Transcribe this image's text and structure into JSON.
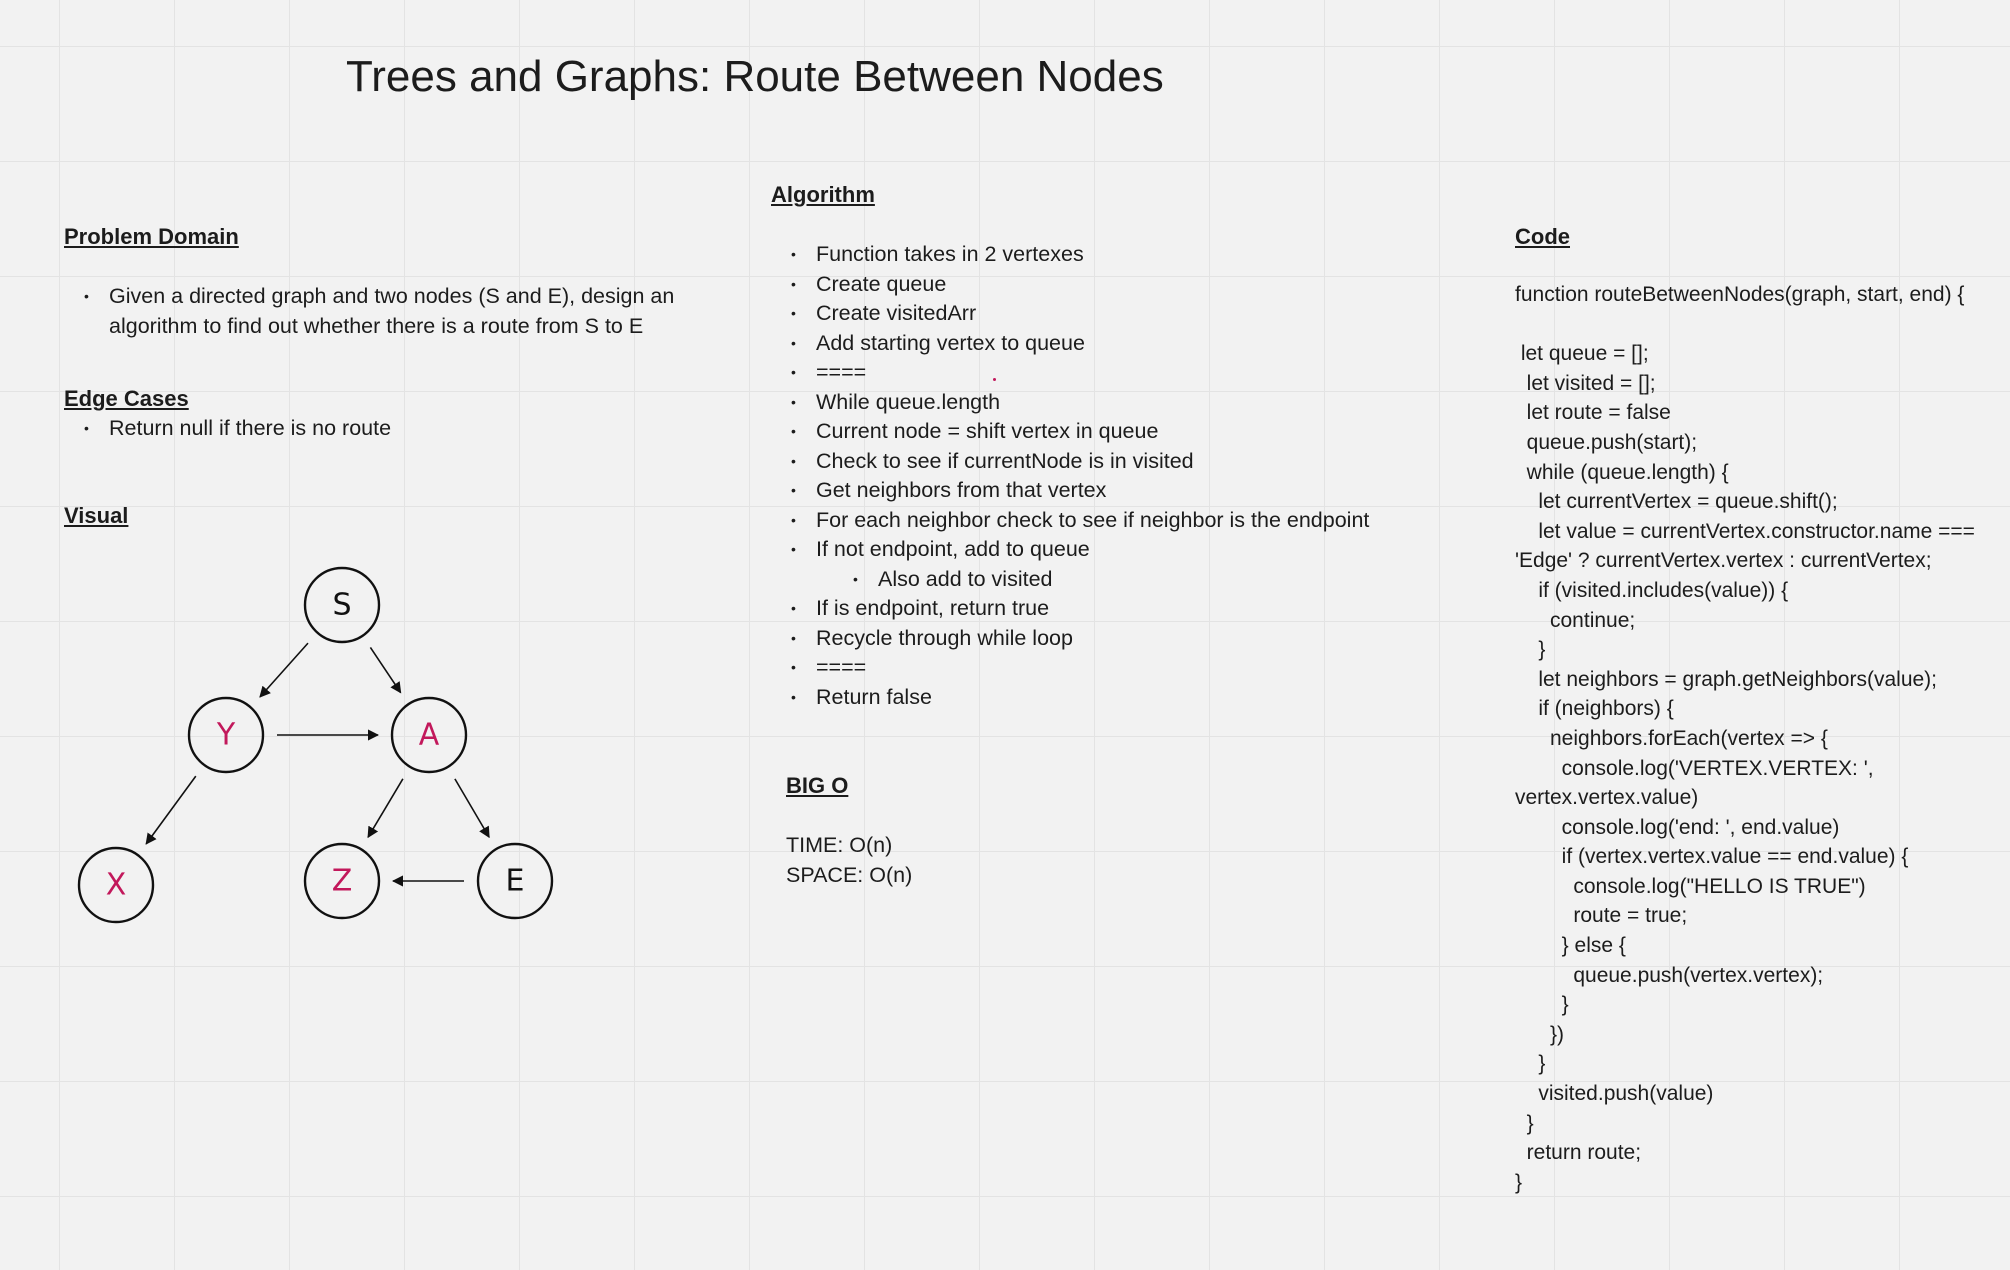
{
  "title": "Trees and Graphs: Route Between Nodes",
  "problem_domain": {
    "heading": "Problem Domain",
    "items": [
      "Given a directed graph and two nodes (S and E), design an algorithm to find out whether there is a route from S to E"
    ]
  },
  "edge_cases": {
    "heading": "Edge Cases",
    "items": [
      "Return null if there is no route"
    ]
  },
  "visual": {
    "heading": "Visual",
    "nodes": [
      {
        "label": "S",
        "color": "#111111"
      },
      {
        "label": "Y",
        "color": "#c2185b"
      },
      {
        "label": "A",
        "color": "#c2185b"
      },
      {
        "label": "X",
        "color": "#c2185b"
      },
      {
        "label": "Z",
        "color": "#c2185b"
      },
      {
        "label": "E",
        "color": "#111111"
      }
    ],
    "edges": [
      {
        "from": "S",
        "to": "Y"
      },
      {
        "from": "S",
        "to": "A"
      },
      {
        "from": "Y",
        "to": "A"
      },
      {
        "from": "Y",
        "to": "X"
      },
      {
        "from": "A",
        "to": "Z"
      },
      {
        "from": "A",
        "to": "E"
      },
      {
        "from": "E",
        "to": "Z"
      }
    ]
  },
  "algorithm": {
    "heading": "Algorithm",
    "items": [
      "Function takes in 2 vertexes",
      "Create queue",
      "Create visitedArr",
      "Add starting vertex to queue",
      "====",
      "While queue.length",
      "Current node = shift vertex in queue",
      "Check to see if currentNode is in visited",
      "Get neighbors from that vertex",
      "For each neighbor check to see if neighbor is the endpoint",
      "If not endpoint, add to queue",
      "Also add to visited",
      "If is endpoint, return true",
      "Recycle through while loop",
      "====",
      "Return false"
    ]
  },
  "big_o": {
    "heading": "BIG O",
    "time": "TIME: O(n)",
    "space": "SPACE: O(n)"
  },
  "code": {
    "heading": "Code",
    "lines": [
      "function routeBetweenNodes(graph, start, end) {",
      "",
      " let queue = [];",
      "  let visited = [];",
      "  let route = false",
      "  queue.push(start);",
      "  while (queue.length) {",
      "    let currentVertex = queue.shift();",
      "    let value = currentVertex.constructor.name ===",
      "'Edge' ? currentVertex.vertex : currentVertex;",
      "    if (visited.includes(value)) {",
      "      continue;",
      "    }",
      "    let neighbors = graph.getNeighbors(value);",
      "    if (neighbors) {",
      "      neighbors.forEach(vertex => {",
      "        console.log('VERTEX.VERTEX: ',",
      "vertex.vertex.value)",
      "        console.log('end: ', end.value)",
      "        if (vertex.vertex.value == end.value) {",
      "          console.log(\"HELLO IS TRUE\")",
      "          route = true;",
      "        } else {",
      "          queue.push(vertex.vertex);",
      "        }",
      "      })",
      "    }",
      "    visited.push(value)",
      "  }",
      "  return route;",
      "}"
    ]
  }
}
